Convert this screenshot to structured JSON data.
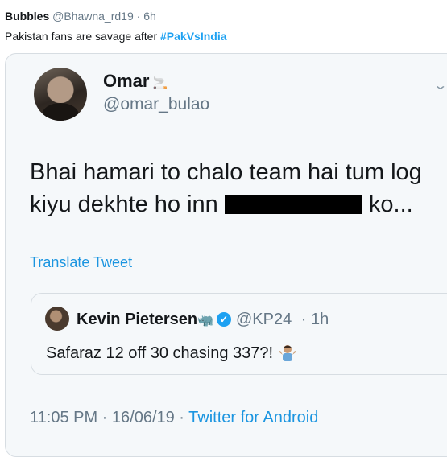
{
  "outer_tweet": {
    "display_name": "Bubbles",
    "handle": "@Bhawna_rd19",
    "time": "· 6h",
    "text": "Pakistan fans are savage after ",
    "hashtag": "#PakVsIndia"
  },
  "quoted_tweet": {
    "display_name": "Omar",
    "display_name_emoji": "🚬",
    "handle": "@omar_bulao",
    "text_line1": "Bhai hamari to chalo team hai tum log",
    "text_line2_start": "kiyu dekhte ho inn ",
    "text_line2_end": " ko...",
    "translate_label": "Translate Tweet",
    "timestamp": "11:05 PM · 16/06/19 · ",
    "source": "Twitter for Android"
  },
  "nested_quote": {
    "display_name": "Kevin Pietersen",
    "display_name_emoji": "🦏",
    "handle": "@KP24",
    "time": "· 1h",
    "text": "Safaraz 12 off 30 chasing 337?! "
  },
  "colors": {
    "link": "#1b95e0",
    "hashtag": "#1da1f2",
    "secondary_text": "#657786",
    "card_background": "#f5f8fa",
    "border": "#d7dde2"
  },
  "icons": {
    "chevron": "chevron-down-icon",
    "verified": "verified-badge-icon",
    "shrug": "person-shrugging-icon"
  }
}
